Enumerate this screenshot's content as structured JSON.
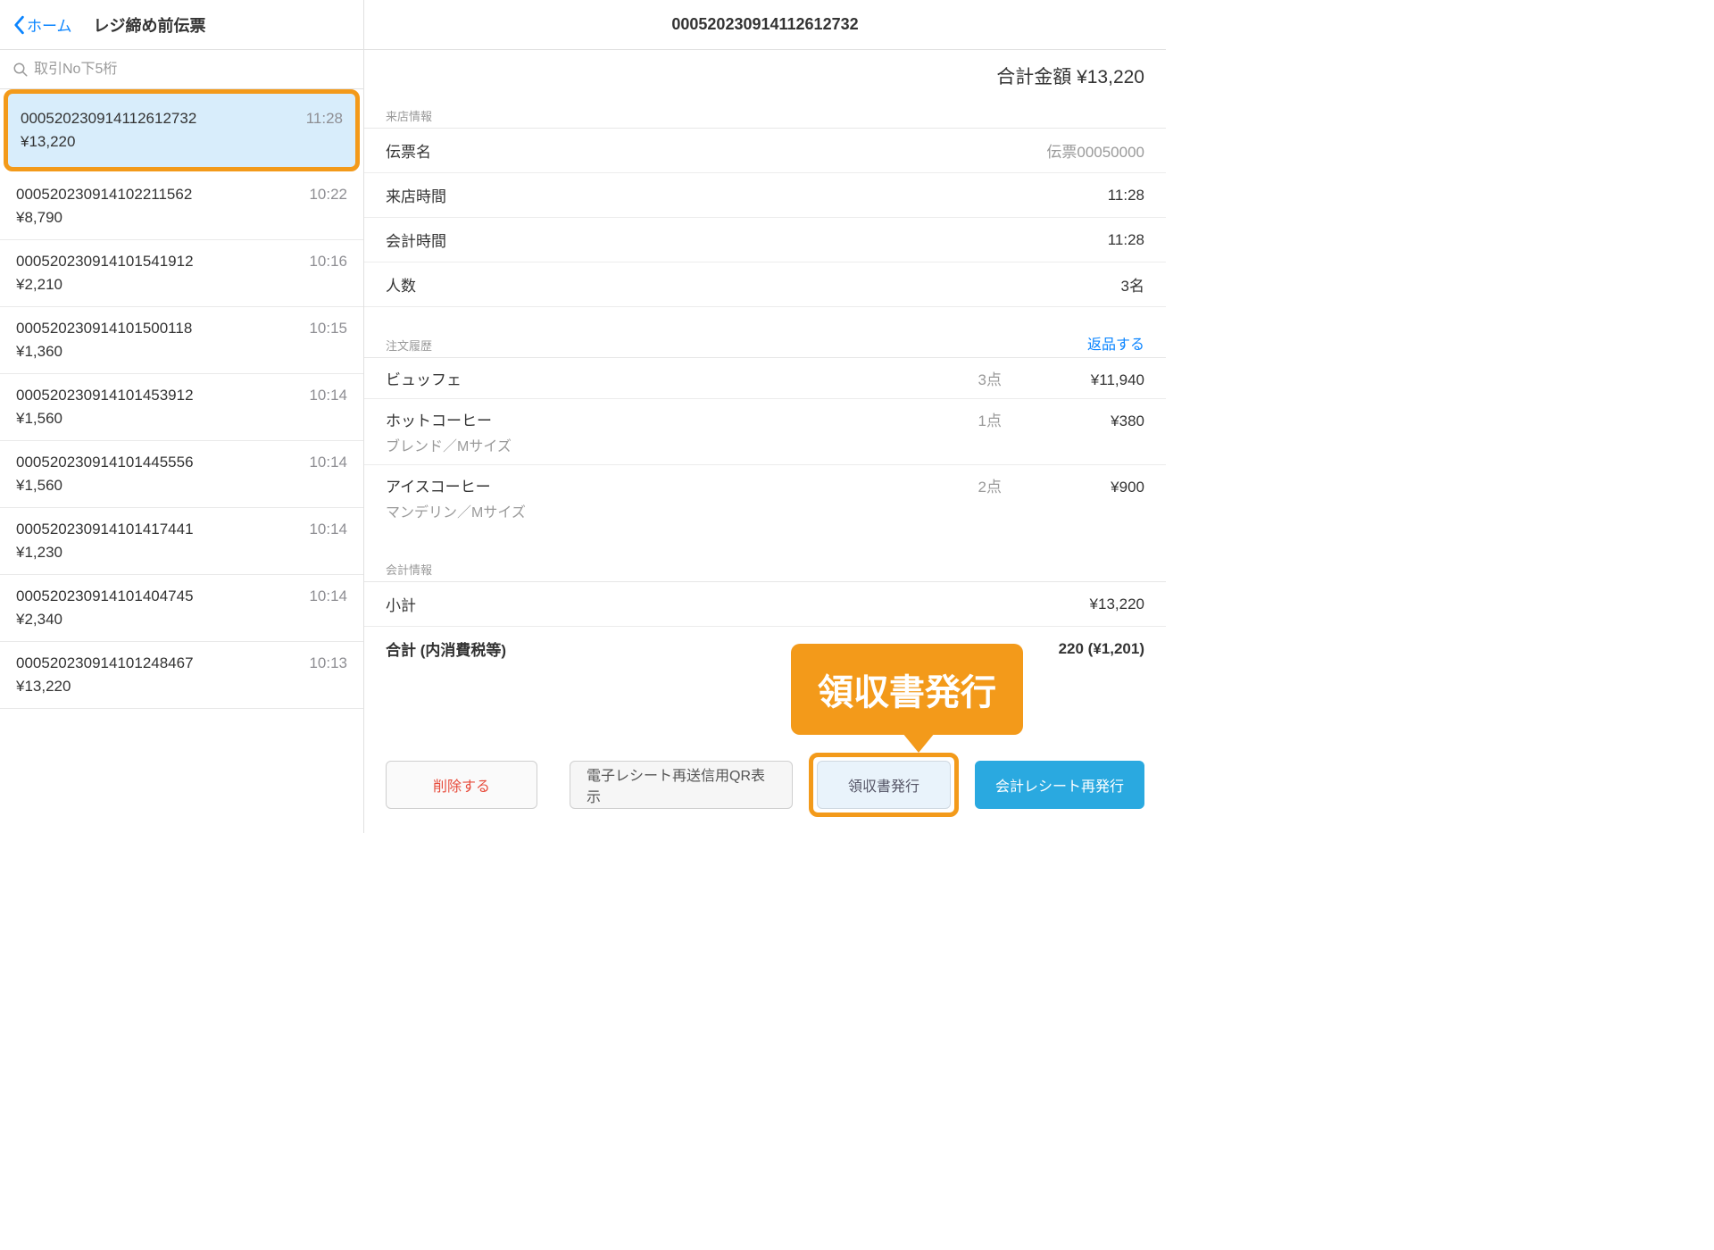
{
  "left": {
    "back_label": "ホーム",
    "title": "レジ締め前伝票",
    "search_placeholder": "取引No下5桁",
    "items": [
      {
        "id": "000520230914112612732",
        "time": "11:28",
        "amount": "¥13,220",
        "selected": true
      },
      {
        "id": "000520230914102211562",
        "time": "10:22",
        "amount": "¥8,790"
      },
      {
        "id": "000520230914101541912",
        "time": "10:16",
        "amount": "¥2,210"
      },
      {
        "id": "000520230914101500118",
        "time": "10:15",
        "amount": "¥1,360"
      },
      {
        "id": "000520230914101453912",
        "time": "10:14",
        "amount": "¥1,560"
      },
      {
        "id": "000520230914101445556",
        "time": "10:14",
        "amount": "¥1,560"
      },
      {
        "id": "000520230914101417441",
        "time": "10:14",
        "amount": "¥1,230"
      },
      {
        "id": "000520230914101404745",
        "time": "10:14",
        "amount": "¥2,340"
      },
      {
        "id": "000520230914101248467",
        "time": "10:13",
        "amount": "¥13,220"
      }
    ]
  },
  "right": {
    "header_id": "000520230914112612732",
    "total_label": "合計金額",
    "total_value": "¥13,220",
    "visit_section": "来店情報",
    "slip_label": "伝票名",
    "slip_value": "伝票00050000",
    "visit_time_label": "来店時間",
    "visit_time_value": "11:28",
    "pay_time_label": "会計時間",
    "pay_time_value": "11:28",
    "people_label": "人数",
    "people_value": "3名",
    "order_section": "注文履歴",
    "return_link": "返品する",
    "orders": [
      {
        "name": "ビュッフェ",
        "qty": "3点",
        "price": "¥11,940",
        "sub": ""
      },
      {
        "name": "ホットコーヒー",
        "qty": "1点",
        "price": "¥380",
        "sub": "ブレンド／Mサイズ"
      },
      {
        "name": "アイスコーヒー",
        "qty": "2点",
        "price": "¥900",
        "sub": "マンデリン／Mサイズ"
      }
    ],
    "account_section": "会計情報",
    "subtotal_label": "小計",
    "subtotal_value": "¥13,220",
    "grand_label": "合計 (内消費税等)",
    "grand_value": "220 (¥1,201)",
    "buttons": {
      "delete": "削除する",
      "qr": "電子レシート再送信用QR表示",
      "receipt": "領収書発行",
      "reprint": "会計レシート再発行"
    },
    "callout": "領収書発行"
  }
}
